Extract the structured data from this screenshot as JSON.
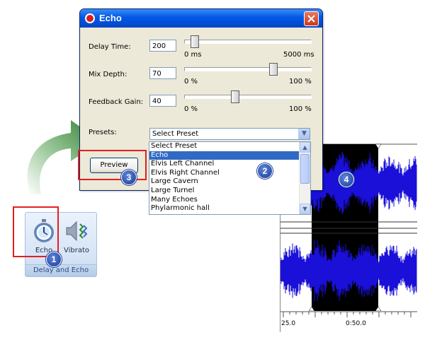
{
  "dialog": {
    "title": "Echo",
    "delay": {
      "label": "Delay Time:",
      "value": "200",
      "min_label": "0 ms",
      "max_label": "5000 ms",
      "position": 0.08
    },
    "mix": {
      "label": "Mix Depth:",
      "value": "70",
      "min_label": "0 %",
      "max_label": "100 %",
      "position": 0.7
    },
    "feedback": {
      "label": "Feedback Gain:",
      "value": "40",
      "min_label": "0 %",
      "max_label": "100 %",
      "position": 0.4
    },
    "presets_label": "Presets:",
    "preset_selected": "Select Preset",
    "preview_label": "Preview"
  },
  "dropdown": {
    "items": [
      "Select Preset",
      "Echo",
      "Elvis Left Channel",
      "Elvis Right Channel",
      "Large Cavern",
      "Large Turnel",
      "Many Echoes",
      "Phylarmonic hall"
    ],
    "selected_index": 1
  },
  "ribbon": {
    "echo_label": "Echo",
    "vibrato_label": "Vibrato",
    "group_label": "Delay and Echo"
  },
  "timeline": {
    "labels": [
      "25.0",
      "0:50.0"
    ]
  },
  "markers": [
    "1",
    "2",
    "3",
    "4"
  ],
  "colors": {
    "waveform": "#1a10d8",
    "selection": "#000000",
    "highlight": "#e02020",
    "marker": "#1a3c9a",
    "arrow": "#2e7d2e"
  }
}
